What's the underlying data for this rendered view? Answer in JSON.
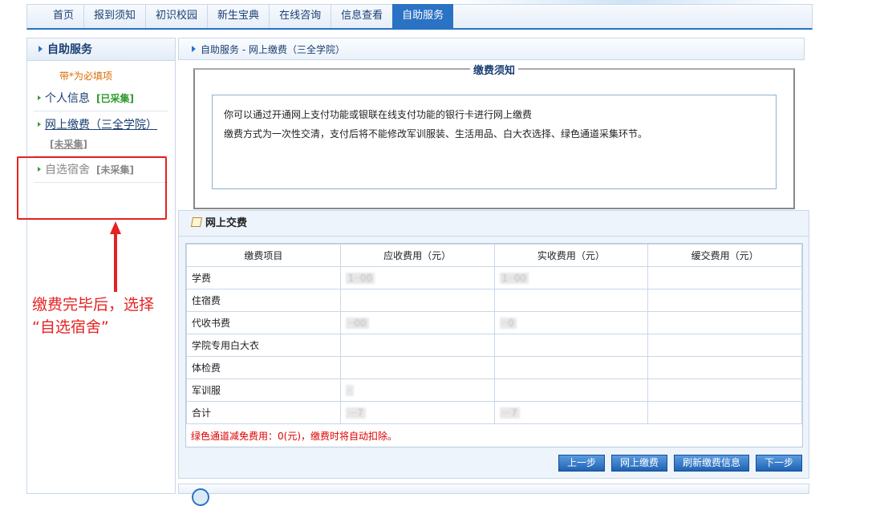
{
  "nav": {
    "tabs": [
      {
        "label": "首页"
      },
      {
        "label": "报到须知"
      },
      {
        "label": "初识校园"
      },
      {
        "label": "新生宝典"
      },
      {
        "label": "在线咨询"
      },
      {
        "label": "信息查看"
      },
      {
        "label": "自助服务"
      }
    ],
    "active_index": 6
  },
  "sidebar": {
    "title": "自助服务",
    "required_note": "带*为必填项",
    "items": [
      {
        "label": "个人信息",
        "status": "[已采集]"
      },
      {
        "label": "网上缴费（三全学院）",
        "status": "[未采集]"
      },
      {
        "label": "自选宿舍",
        "status": "[未采集]"
      }
    ]
  },
  "annotation": {
    "text": "缴费完毕后，选择\n“自选宿舍”",
    "color": "#e52222"
  },
  "main": {
    "breadcrumb": "自助服务 - 网上缴费（三全学院）",
    "notice": {
      "legend": "缴费须知",
      "line1": "你可以通过开通网上支付功能或银联在线支付功能的银行卡进行网上缴费",
      "line2": "缴费方式为一次性交清，支付后将不能修改军训服装、生活用品、白大衣选择、绿色通道采集环节。"
    },
    "payment": {
      "title": "网上交费",
      "headers": [
        "缴费项目",
        "应收费用（元）",
        "实收费用（元）",
        "缓交费用（元）"
      ],
      "rows": [
        {
          "item": "学费",
          "due": "1··00",
          "paid": "1··00",
          "deferred": ""
        },
        {
          "item": "住宿费",
          "due": "",
          "paid": "",
          "deferred": ""
        },
        {
          "item": "代收书费",
          "due": "··00",
          "paid": "··0",
          "deferred": ""
        },
        {
          "item": "学院专用白大衣",
          "due": "",
          "paid": "",
          "deferred": ""
        },
        {
          "item": "体检费",
          "due": "",
          "paid": "",
          "deferred": ""
        },
        {
          "item": "军训服",
          "due": "·",
          "paid": "",
          "deferred": ""
        },
        {
          "item": "合计",
          "due": "···7",
          "paid": "···7",
          "deferred": ""
        }
      ],
      "green_note": "绿色通道减免费用：0(元)，缴费时将自动扣除。"
    },
    "buttons": {
      "prev": "上一步",
      "pay_online": "网上缴费",
      "refresh": "刷新缴费信息",
      "next": "下一步"
    }
  }
}
